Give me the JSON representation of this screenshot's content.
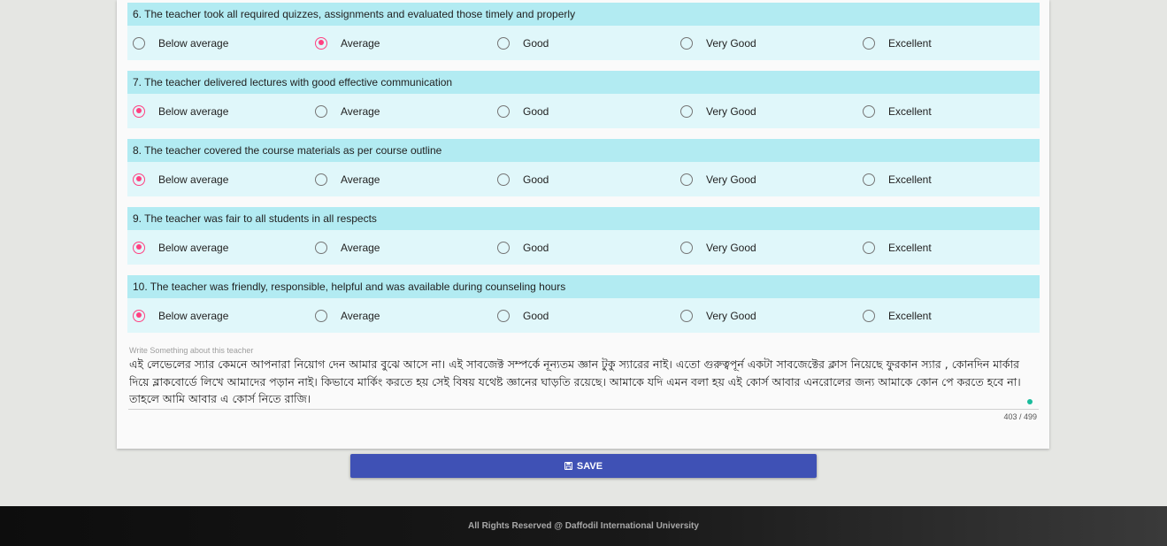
{
  "options": [
    "Below average",
    "Average",
    "Good",
    "Very Good",
    "Excellent"
  ],
  "questions": [
    {
      "text": "6. The teacher took all required quizzes, assignments and evaluated those timely and properly",
      "selected": 1
    },
    {
      "text": "7. The teacher delivered lectures with good effective communication",
      "selected": 0
    },
    {
      "text": "8. The teacher covered the course materials as per course outline",
      "selected": 0
    },
    {
      "text": "9. The teacher was fair to all students in all respects",
      "selected": 0
    },
    {
      "text": "10. The teacher was friendly, responsible, helpful and was available during counseling hours",
      "selected": 0
    }
  ],
  "comment": {
    "label": "Write Something about this teacher",
    "value": "এই লেভেলের স্যার কেমনে আপনারা নিয়োগ দেন আমার বুঝে আসে না। এই সাবজেক্ট সম্পর্কে নূন্যতম জ্ঞান টুকু স্যারের নাই।  এতো গুরুত্বপূর্ন একটা সাবজেক্টের ক্লাস নিয়েছে ফুরকান স্যার , কোনদিন মার্কার দিয়ে ব্লাকবোর্ডে লিখে আমাদের পড়ান নাই। কিভাবে মার্কিং করতে হয় সেই বিষয় যথেষ্ট জ্ঞানের ঘাড়তি রয়েছে। আমাকে যদি এমন বলা হয় এই কোর্স আবার  এনরোলের জন্য আমাকে কোন পে করতে হবে না। তাহলে আমি আবার এ কোর্স নিতে রাজি।",
    "counter": "403 / 499"
  },
  "save_button": {
    "label": "SAVE",
    "icon": "floppy-disk-icon"
  },
  "footer": {
    "text": "All Rights Reserved @ Daffodil International University"
  },
  "colors": {
    "accent": "#ff4081",
    "header_bg": "#b2ebf2",
    "options_bg": "#e0f7fa",
    "button": "#3f51b5"
  }
}
